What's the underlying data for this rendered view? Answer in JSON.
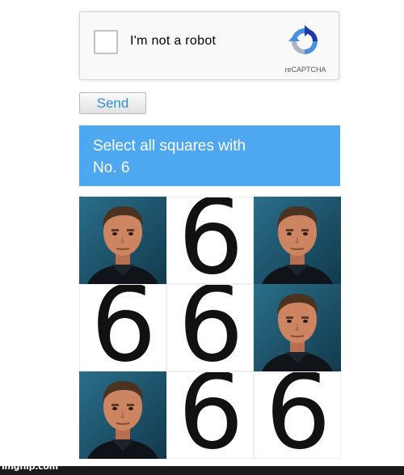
{
  "recaptcha": {
    "checkbox_label": "I'm not a robot",
    "brand": "reCAPTCHA",
    "logo_icon": "recaptcha-logo-icon",
    "checked": false
  },
  "send_button": {
    "label": "Send"
  },
  "challenge": {
    "prompt_line1": "Select all squares with",
    "prompt_line2": "No. 6",
    "accent_color": "#4da8ef",
    "tiles": [
      {
        "type": "portrait"
      },
      {
        "type": "digit",
        "text": "6"
      },
      {
        "type": "portrait"
      },
      {
        "type": "digit",
        "text": "6"
      },
      {
        "type": "digit",
        "text": "6"
      },
      {
        "type": "portrait"
      },
      {
        "type": "portrait"
      },
      {
        "type": "digit",
        "text": "6"
      },
      {
        "type": "digit",
        "text": "6"
      }
    ]
  },
  "watermark": "imgflip.com"
}
